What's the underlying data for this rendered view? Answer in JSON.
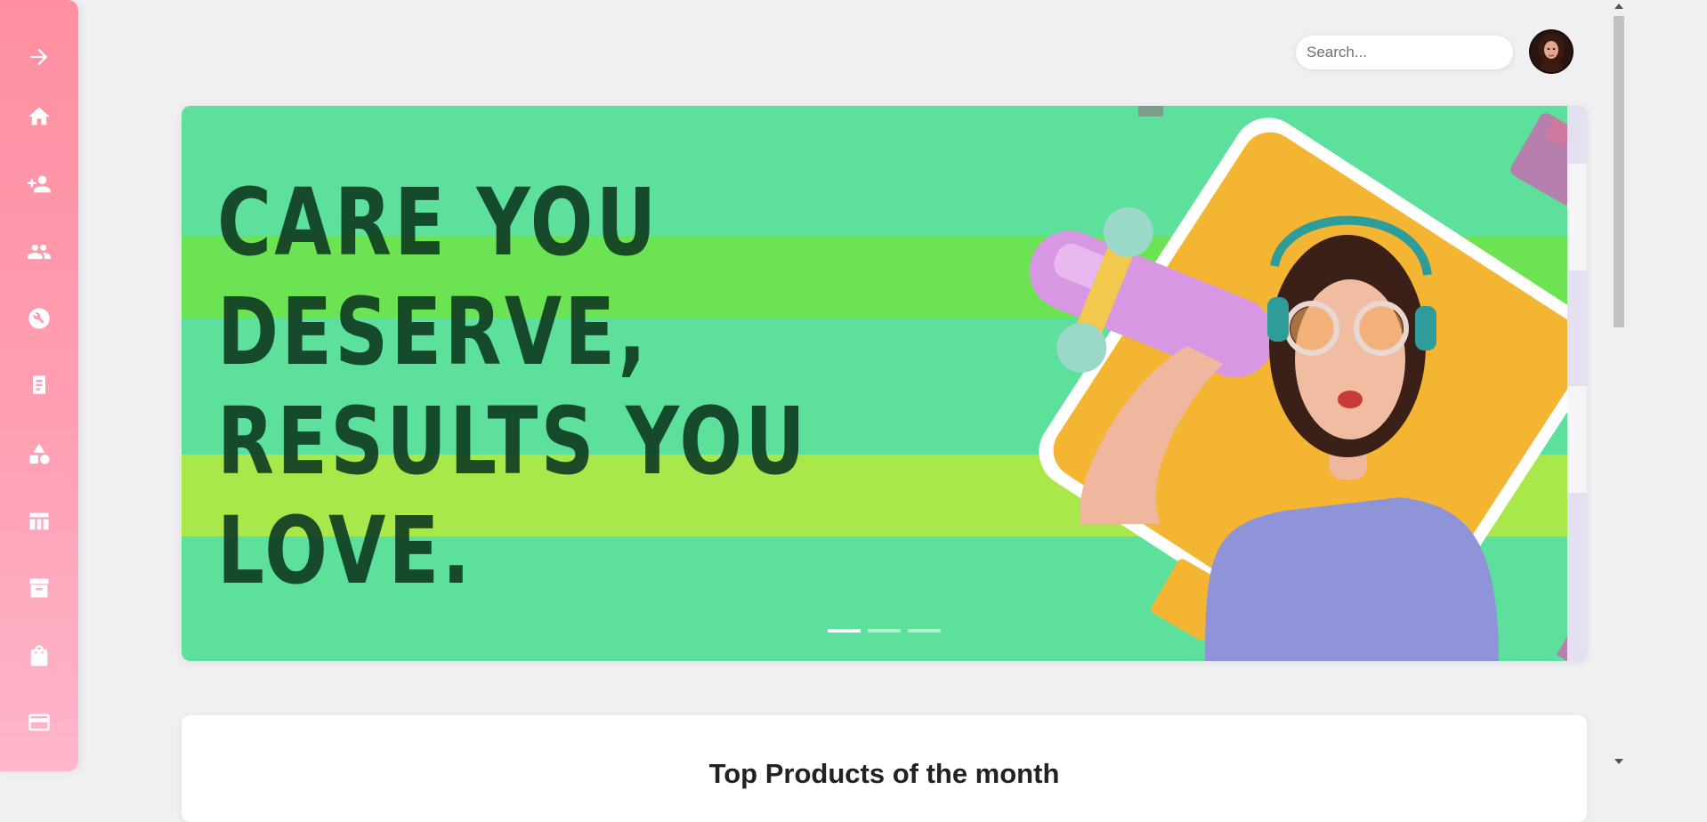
{
  "sidebar": {
    "items": [
      {
        "icon": "arrow-right-icon"
      },
      {
        "icon": "home-icon"
      },
      {
        "icon": "add-user-icon"
      },
      {
        "icon": "users-icon"
      },
      {
        "icon": "wrench-icon"
      },
      {
        "icon": "receipt-icon"
      },
      {
        "icon": "shapes-icon"
      },
      {
        "icon": "table-icon"
      },
      {
        "icon": "archive-icon"
      },
      {
        "icon": "shopping-bag-icon"
      },
      {
        "icon": "credit-card-icon"
      }
    ],
    "colors": {
      "top": "#fe8fa0",
      "bottom": "#feb6cb",
      "icon": "#ffffff"
    }
  },
  "header": {
    "search": {
      "placeholder": "Search...",
      "value": ""
    },
    "avatar": {
      "icon": "user-avatar"
    }
  },
  "banner": {
    "headline_lines": [
      "CARE YOU",
      "DESERVE,",
      "RESULTS YOU",
      "LOVE."
    ],
    "carousel": {
      "slides": 3,
      "active_index": 0
    },
    "colors": {
      "background": "#5de09c",
      "band_upper": "#6ce352",
      "band_lower": "#a9e84a",
      "diamond": "#f4b533",
      "headline": "#0f3a22"
    }
  },
  "products_section": {
    "title": "Top Products of the month"
  }
}
